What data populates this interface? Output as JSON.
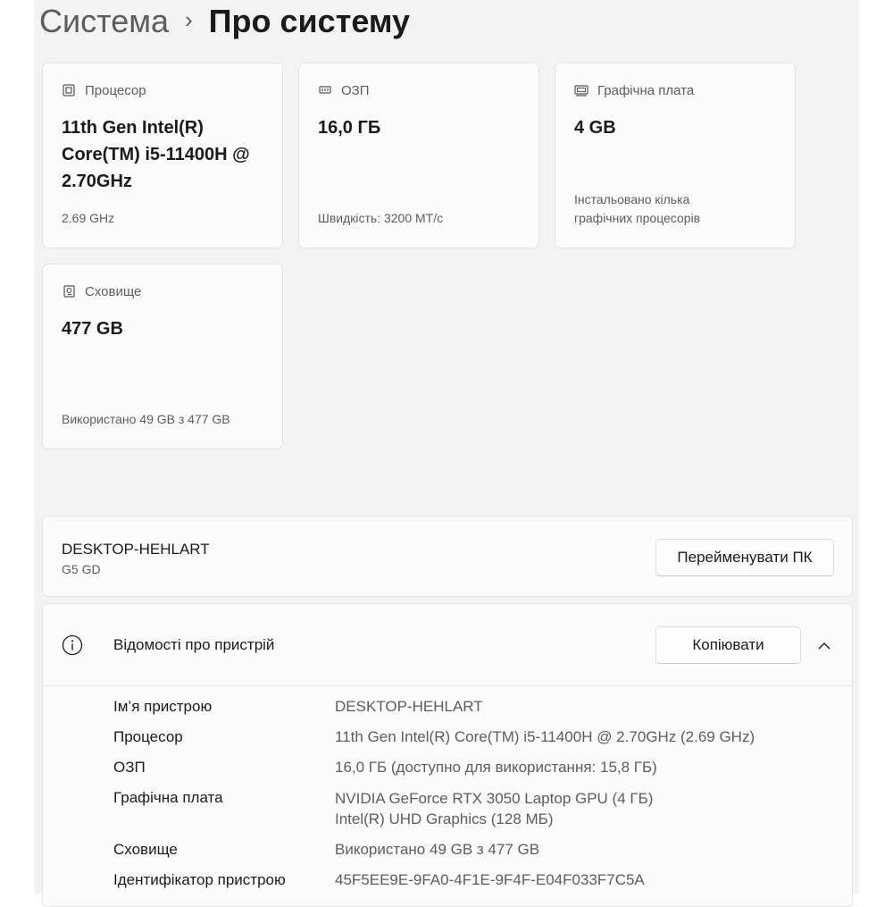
{
  "breadcrumb": {
    "parent": "Система",
    "separator": "›",
    "current": "Про систему"
  },
  "specs": {
    "cpu": {
      "icon": "cpu-icon",
      "label": "Процесор",
      "value_lines": [
        "11th Gen Intel(R)",
        "Core(TM) i5-11400H @",
        "2.70GHz"
      ],
      "note": "2.69 GHz"
    },
    "ram": {
      "icon": "ram-icon",
      "label": "ОЗП",
      "value": "16,0 ГБ",
      "note": "Швидкість: 3200 МТ/с"
    },
    "gpu": {
      "icon": "gpu-icon",
      "label": "Графічна плата",
      "value": "4 GB",
      "note_lines": [
        "Інстальовано кілька",
        "графічних процесорів"
      ]
    },
    "storage": {
      "icon": "storage-icon",
      "label": "Сховище",
      "value": "477 GB",
      "note": "Використано 49 GB з 477 GB"
    }
  },
  "device": {
    "name": "DESKTOP-HEHLART",
    "model": "G5 GD",
    "rename_label": "Перейменувати ПК"
  },
  "details": {
    "title": "Відомості про пристрій",
    "copy_label": "Копіювати",
    "rows": [
      {
        "label": "Ім’я пристрою",
        "value": "DESKTOP-HEHLART"
      },
      {
        "label": "Процесор",
        "value": "11th Gen Intel(R) Core(TM) i5-11400H @ 2.70GHz (2.69 GHz)"
      },
      {
        "label": "ОЗП",
        "value": "16,0 ГБ (доступно для використання: 15,8 ГБ)"
      },
      {
        "label": "Графічна плата",
        "value": "NVIDIA GeForce RTX 3050 Laptop GPU (4 ГБ)",
        "value2": "Intel(R) UHD Graphics (128 МБ)"
      },
      {
        "label": "Сховище",
        "value": "Використано 49 GB з 477 GB"
      },
      {
        "label": "Ідентифікатор пристрою",
        "value": "45F5EE9E-9FA0-4F1E-9F4F-E04F033F7C5A"
      }
    ]
  }
}
